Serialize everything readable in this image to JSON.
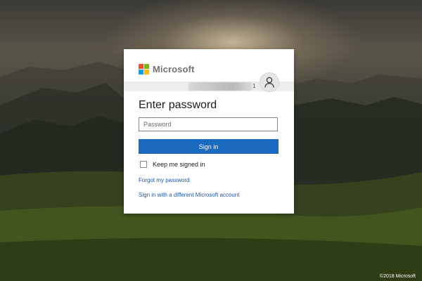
{
  "brand": {
    "name": "Microsoft",
    "colors": {
      "red": "#f25022",
      "green": "#7fba00",
      "blue": "#00a4ef",
      "yellow": "#ffb900"
    }
  },
  "identity": {
    "tail": "1",
    "avatar_icon": "user-icon"
  },
  "form": {
    "title": "Enter password",
    "password_placeholder": "Password",
    "signin_label": "Sign in",
    "keep_signed_in_label": "Keep me signed in",
    "keep_signed_in_checked": false
  },
  "links": {
    "forgot_password": "Forgot my password",
    "different_account": "Sign in with a different Microsoft account"
  },
  "footer": {
    "copyright": "©2018 Microsoft"
  },
  "theme": {
    "button_color": "#1b6ac0",
    "link_color": "#1e56a8"
  }
}
